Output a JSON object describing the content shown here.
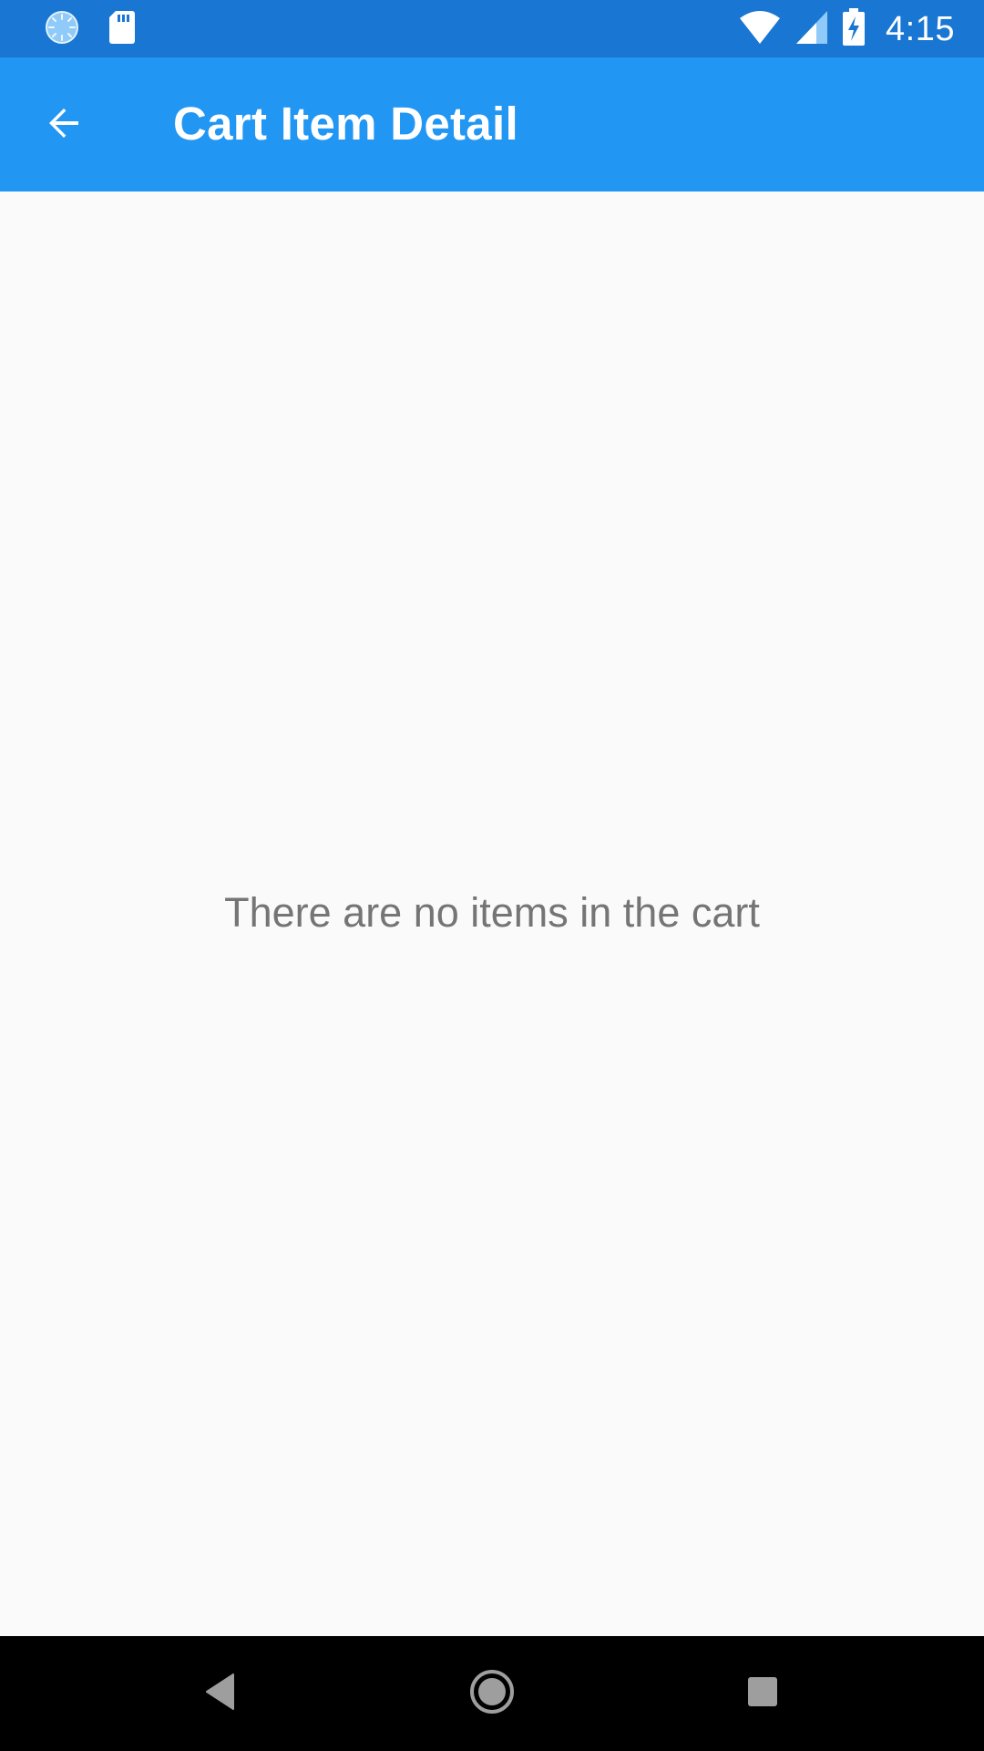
{
  "status_bar": {
    "time": "4:15",
    "background_color": "#1976D2",
    "icons_left": [
      "sync-icon",
      "sd-card-icon"
    ],
    "icons_right": [
      "wifi-icon",
      "cell-signal-icon",
      "battery-charging-icon"
    ]
  },
  "app_bar": {
    "title": "Cart Item Detail",
    "background_color": "#2196F3",
    "back_icon": "arrow-back-icon"
  },
  "content": {
    "empty_message": "There are no items in the cart",
    "background_color": "#FAFAFA",
    "text_color": "#757575"
  },
  "nav_bar": {
    "buttons": [
      "back-triangle-icon",
      "home-circle-icon",
      "recents-square-icon"
    ],
    "background_color": "#000000"
  }
}
